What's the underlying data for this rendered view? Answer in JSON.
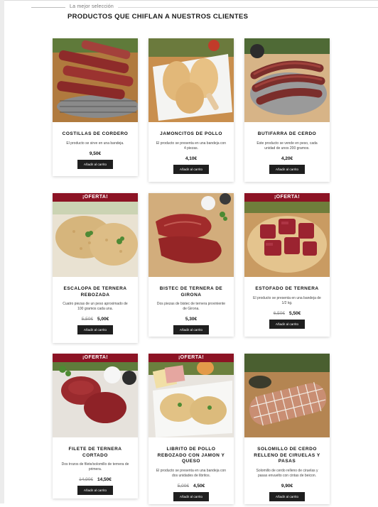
{
  "header": {
    "kicker": "La mejor selección",
    "title": "PRODUCTOS QUE CHIFLAN A NUESTROS CLIENTES"
  },
  "offer_label": "¡OFERTA!",
  "button_label": "Añadir al carrito",
  "colors": {
    "offer": "#8c1324",
    "button": "#1f1f1f"
  },
  "products": [
    {
      "name": "COSTILLAS DE CORDERO",
      "desc": "El producto se sirve en una bandeja.",
      "price": "9,50€",
      "old_price": "",
      "offer": false
    },
    {
      "name": "JAMONCITOS DE POLLO",
      "desc": "El producto se presenta en una bandeja con 4 piezas.",
      "price": "4,10€",
      "old_price": "",
      "offer": false
    },
    {
      "name": "BUTIFARRA DE CERDO",
      "desc": "Este producto se vende en peso, cada unidad de unos 200 gramos.",
      "price": "4,20€",
      "old_price": "",
      "offer": false
    },
    {
      "name": "ESCALOPA DE TERNERA REBOZADA",
      "desc": "Cuatro piezas de un peso aproximado de 100 gramos cada una.",
      "price": "5,00€",
      "old_price": "5,50€",
      "offer": true
    },
    {
      "name": "BISTEC DE TERNERA DE GIRONA",
      "desc": "Dos piezas de bistec de ternera proviniente de Girona.",
      "price": "5,30€",
      "old_price": "",
      "offer": false
    },
    {
      "name": "ESTOFADO DE TERNERA",
      "desc": "El producto se presenta en una bandeja de 1/2 kg.",
      "price": "5,50€",
      "old_price": "6,50€",
      "offer": true
    },
    {
      "name": "FILETE DE TERNERA CORTADO",
      "desc": "Dos trozos de filete/solomillo de ternera de primera.",
      "price": "14,50€",
      "old_price": "14,90€",
      "offer": true
    },
    {
      "name": "LIBRITO DE POLLO REBOZADO CON JAMON Y QUESO",
      "desc": "El producto se presenta en una bandeja con dos unidades de libritos.",
      "price": "4,50€",
      "old_price": "5,00€",
      "offer": true
    },
    {
      "name": "SOLOMILLO DE CERDO RELLENO DE CIRUELAS Y PASAS",
      "desc": "Solomillo de cerdo relleno de ciruelas y pasas envuelto con cintas de beicon.",
      "price": "9,90€",
      "old_price": "",
      "offer": false
    }
  ]
}
